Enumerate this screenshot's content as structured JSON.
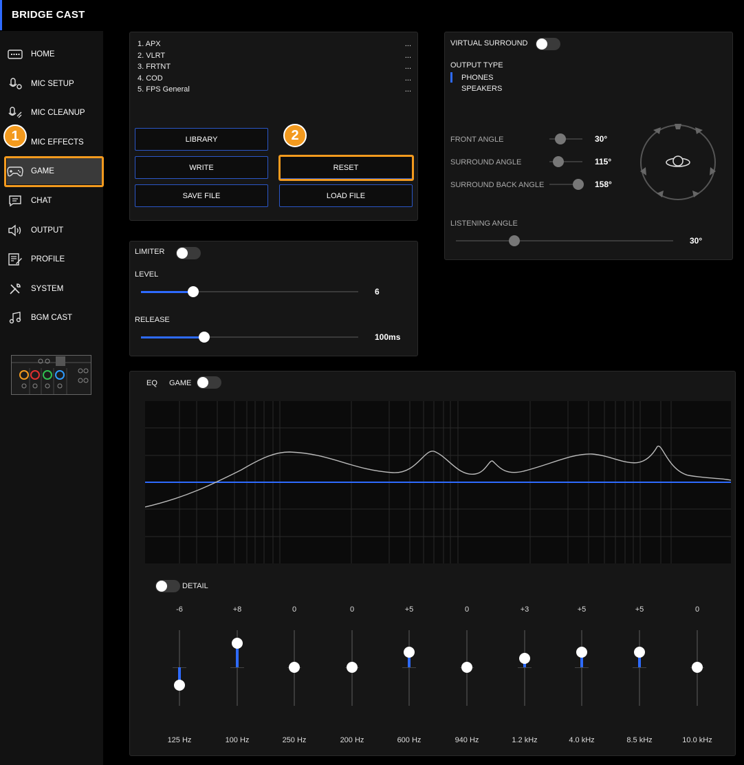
{
  "app": {
    "title": "BRIDGE CAST"
  },
  "sidebar": {
    "items": [
      {
        "label": "HOME",
        "icon": "keyboard-icon"
      },
      {
        "label": "MIC SETUP",
        "icon": "mic-setup-icon"
      },
      {
        "label": "MIC CLEANUP",
        "icon": "mic-cleanup-icon"
      },
      {
        "label": "MIC EFFECTS",
        "icon": "mic-effects-icon"
      },
      {
        "label": "GAME",
        "icon": "gamepad-icon",
        "active": true
      },
      {
        "label": "CHAT",
        "icon": "chat-icon"
      },
      {
        "label": "OUTPUT",
        "icon": "speaker-icon"
      },
      {
        "label": "PROFILE",
        "icon": "profile-icon"
      },
      {
        "label": "SYSTEM",
        "icon": "wrench-icon"
      },
      {
        "label": "BGM CAST",
        "icon": "music-icon"
      }
    ]
  },
  "presets": {
    "items": [
      {
        "name": "1. APX",
        "more": "..."
      },
      {
        "name": "2. VLRT",
        "more": "..."
      },
      {
        "name": "3. FRTNT",
        "more": "..."
      },
      {
        "name": "4. COD",
        "more": "..."
      },
      {
        "name": "5. FPS General",
        "more": "..."
      }
    ],
    "buttons": {
      "library": "LIBRARY",
      "write": "WRITE",
      "reset": "RESET",
      "save_file": "SAVE FILE",
      "load_file": "LOAD FILE"
    }
  },
  "limiter": {
    "label": "LIMITER",
    "enabled": false,
    "level": {
      "label": "LEVEL",
      "value": "6",
      "fraction": 0.24
    },
    "release": {
      "label": "RELEASE",
      "value": "100ms",
      "fraction": 0.29
    }
  },
  "surround": {
    "label": "VIRTUAL SURROUND",
    "enabled": false,
    "output_type_label": "OUTPUT TYPE",
    "output_types": [
      "PHONES",
      "SPEAKERS"
    ],
    "selected_output": "PHONES",
    "front_angle": {
      "label": "FRONT ANGLE",
      "value": "30°",
      "fraction": 0.33
    },
    "surround_angle": {
      "label": "SURROUND ANGLE",
      "value": "115°",
      "fraction": 0.27
    },
    "surround_back_angle": {
      "label": "SURROUND BACK ANGLE",
      "value": "158°",
      "fraction": 0.88
    },
    "listening_angle": {
      "label": "LISTENING ANGLE",
      "value": "30°",
      "fraction": 0.27
    }
  },
  "eq": {
    "label": "EQ",
    "target_label": "GAME",
    "enabled": false,
    "detail_label": "DETAIL",
    "detail_enabled": false,
    "bands": [
      {
        "value": "-6",
        "freq": "125 Hz",
        "gain": -6
      },
      {
        "value": "+8",
        "freq": "100 Hz",
        "gain": 8
      },
      {
        "value": "0",
        "freq": "250 Hz",
        "gain": 0
      },
      {
        "value": "0",
        "freq": "200 Hz",
        "gain": 0
      },
      {
        "value": "+5",
        "freq": "600 Hz",
        "gain": 5
      },
      {
        "value": "0",
        "freq": "940 Hz",
        "gain": 0
      },
      {
        "value": "+3",
        "freq": "1.2 kHz",
        "gain": 3
      },
      {
        "value": "+5",
        "freq": "4.0 kHz",
        "gain": 5
      },
      {
        "value": "+5",
        "freq": "8.5 kHz",
        "gain": 5
      },
      {
        "value": "0",
        "freq": "10.0 kHz",
        "gain": 0
      }
    ]
  },
  "annotations": {
    "callout_1": "1",
    "callout_2": "2"
  },
  "colors": {
    "accent": "#2e6bff",
    "highlight": "#f39a1e",
    "background": "#000000",
    "panel": "#161616"
  }
}
